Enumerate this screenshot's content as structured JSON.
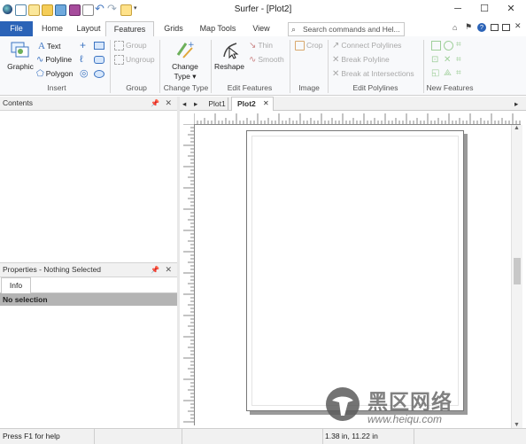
{
  "window": {
    "title": "Surfer - [Plot2]",
    "minimize": "─",
    "maximize": "☐",
    "close": "✕"
  },
  "tabs": {
    "file": "File",
    "home": "Home",
    "layout": "Layout",
    "features": "Features",
    "grids": "Grids",
    "map_tools": "Map Tools",
    "view": "View"
  },
  "search": {
    "placeholder": "Search commands and Hel..."
  },
  "ribbon": {
    "insert": {
      "label": "Insert",
      "graphic": "Graphic",
      "text": "Text",
      "polyline": "Polyline",
      "polygon": "Polygon"
    },
    "group": {
      "label": "Group",
      "group": "Group",
      "ungroup": "Ungroup"
    },
    "change_type": {
      "label": "Change Type",
      "line1": "Change",
      "line2": "Type"
    },
    "edit_features": {
      "label": "Edit Features",
      "reshape": "Reshape",
      "thin": "Thin",
      "smooth": "Smooth"
    },
    "image": {
      "label": "Image",
      "crop": "Crop"
    },
    "edit_polylines": {
      "label": "Edit Polylines",
      "connect": "Connect Polylines",
      "break": "Break Polyline",
      "break_at": "Break at Intersections"
    },
    "new_features": {
      "label": "New Features"
    }
  },
  "contents_panel": {
    "title": "Contents"
  },
  "properties_panel": {
    "title": "Properties - Nothing Selected",
    "tab": "Info",
    "message": "No selection"
  },
  "documents": [
    {
      "label": "Plot1"
    },
    {
      "label": "Plot2",
      "active": true
    }
  ],
  "status": {
    "help": "Press F1 for help",
    "coords": "1.38 in, 11.22 in"
  },
  "watermark": {
    "text": "黑区网络",
    "url": "www.heiqu.com"
  },
  "colors": {
    "file_tab": "#2b63b7",
    "accent": "#2b63b7"
  }
}
